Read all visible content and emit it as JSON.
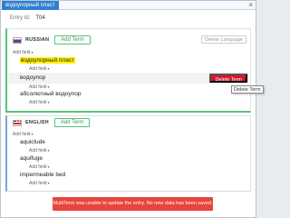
{
  "window": {
    "tab_label": "водоупорный пласт",
    "close_glyph": "×"
  },
  "entry": {
    "label": "Entry Id:",
    "value": "T04"
  },
  "russian": {
    "lang_name": "RUSSIAN",
    "flag": "flag-russia-icon",
    "add_term_label": "Add Term",
    "delete_language_label": "Delete Language",
    "add_field_label": "Add field",
    "terms": [
      {
        "text": "водоупорный пласт",
        "highlighted": true,
        "add_field_label": "Add field"
      },
      {
        "text": "водоупор",
        "highlighted": false,
        "add_field_label": "Add field"
      },
      {
        "text": "абсолютный водоупор",
        "highlighted": false,
        "add_field_label": "Add field"
      }
    ],
    "delete_term_label": "Delete Term",
    "tooltip": "Delete Term"
  },
  "english": {
    "lang_name": "ENGLISH",
    "flag": "flag-uk-icon",
    "add_term_label": "Add Term",
    "add_field_label": "Add field",
    "terms": [
      {
        "text": "aquiclude",
        "add_field_label": "Add field"
      },
      {
        "text": "aquifuge",
        "add_field_label": "Add field"
      },
      {
        "text": "impermeable bed",
        "add_field_label": "Add field"
      }
    ]
  },
  "caret_glyph": "▾",
  "toast": {
    "message": "MultiTerm was unable to update the entry. No new data has been saved.",
    "color": "#e8453c"
  },
  "colors": {
    "tab_blue": "#2f7fd1",
    "russian_accent": "#58c27a",
    "english_accent": "#7aa3d8",
    "highlight": "#fff200",
    "delete_red": "#d9142b"
  }
}
